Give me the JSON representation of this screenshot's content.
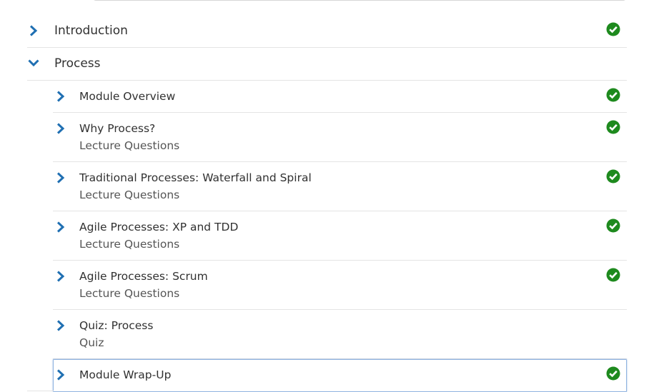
{
  "colors": {
    "chevron": "#1f6fb2",
    "check_green": "#1e8a1e",
    "text": "#313131",
    "meta_text": "#555555",
    "divider": "#e4e4e4",
    "focus_border": "#8fb3e0"
  },
  "icons": {
    "collapsed": "chevron-right-icon",
    "expanded": "chevron-down-icon",
    "complete": "check-circle-icon"
  },
  "outline": {
    "sections": [
      {
        "title": "Introduction",
        "expanded": false,
        "completed": true,
        "items": []
      },
      {
        "title": "Process",
        "expanded": true,
        "completed": false,
        "items": [
          {
            "title": "Module Overview",
            "meta": "",
            "completed": true
          },
          {
            "title": "Why Process?",
            "meta": "Lecture Questions",
            "completed": true
          },
          {
            "title": "Traditional Processes: Waterfall and Spiral",
            "meta": "Lecture Questions",
            "completed": true
          },
          {
            "title": "Agile Processes: XP and TDD",
            "meta": "Lecture Questions",
            "completed": true
          },
          {
            "title": "Agile Processes: Scrum",
            "meta": "Lecture Questions",
            "completed": true
          },
          {
            "title": "Quiz: Process",
            "meta": "Quiz",
            "completed": false
          },
          {
            "title": "Module Wrap-Up",
            "meta": "",
            "completed": true,
            "focused": true
          }
        ]
      }
    ]
  }
}
